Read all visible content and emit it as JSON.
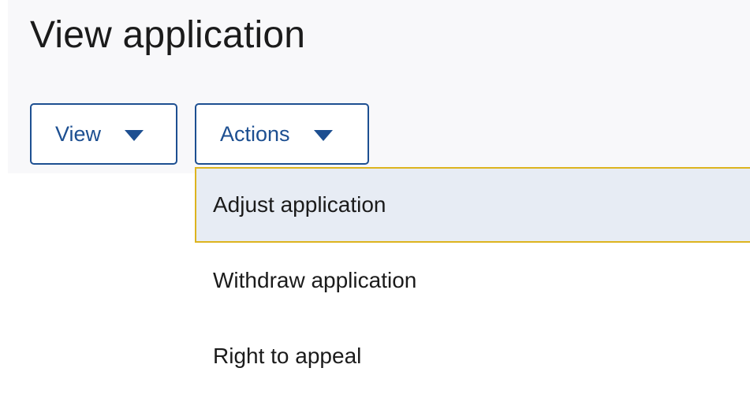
{
  "page": {
    "title": "View application"
  },
  "toolbar": {
    "view_label": "View",
    "view_icon": "caret-down-icon",
    "actions_label": "Actions",
    "actions_icon": "caret-down-icon"
  },
  "actions_menu": {
    "expanded": true,
    "items": [
      {
        "label": "Adjust application",
        "state": "focused"
      },
      {
        "label": "Withdraw application",
        "state": "default"
      },
      {
        "label": "Right to appeal",
        "state": "default"
      }
    ]
  },
  "colors": {
    "primary": "#1d4f91",
    "focus_outline": "#ddb41f",
    "focused_item_bg": "#e7ecf4",
    "header_bg": "#f8f8fa",
    "text": "#1b1b1b"
  }
}
